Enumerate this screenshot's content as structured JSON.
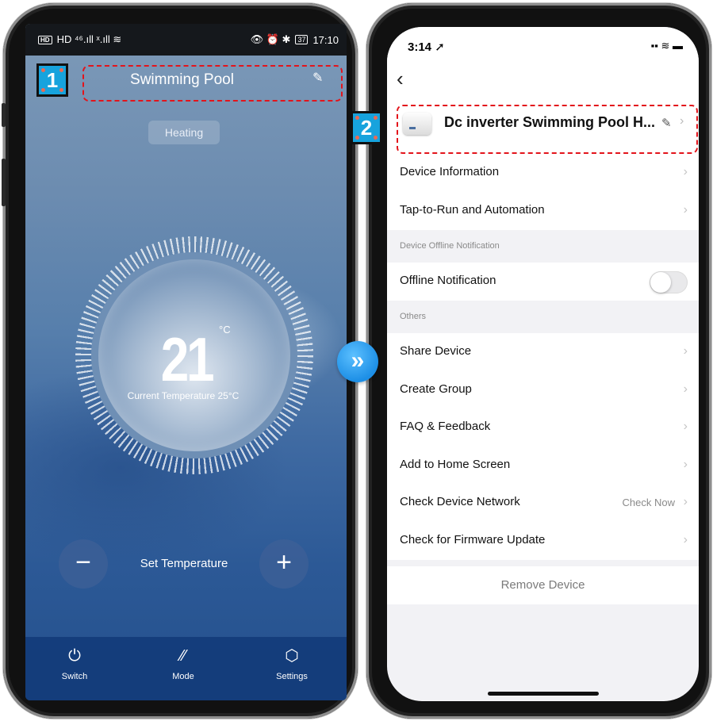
{
  "left_phone": {
    "status_bar": {
      "left": "HD ⁴⁶.ıll ˣ.ıll ≋",
      "right_icons": "👁 ⏰ ✱",
      "battery": "37",
      "time": "17:10"
    },
    "title": "Swimming Pool",
    "mode_badge": "Heating",
    "target_temperature": "21",
    "unit": "°C",
    "current_temperature": "Current Temperature 25°C",
    "set_temperature_label": "Set Temperature",
    "minus": "−",
    "plus": "+",
    "tabs": [
      {
        "label": "Switch",
        "icon": "power-icon",
        "glyph": "⏻"
      },
      {
        "label": "Mode",
        "icon": "mode-icon",
        "glyph": "⁄⁄"
      },
      {
        "label": "Settings",
        "icon": "settings-cube-icon",
        "glyph": "⬡"
      }
    ]
  },
  "right_phone": {
    "status_bar": {
      "time": "3:14 ➚",
      "icons": "▪▪ ≋ ▬"
    },
    "device_name": "Dc inverter Swimming Pool H...",
    "rows": {
      "device_information": "Device Information",
      "tap_to_run": "Tap-to-Run and Automation",
      "section_offline": "Device Offline Notification",
      "offline_notification": "Offline Notification",
      "offline_notification_enabled": false,
      "section_others": "Others",
      "share_device": "Share Device",
      "create_group": "Create Group",
      "faq": "FAQ & Feedback",
      "add_home": "Add to Home Screen",
      "check_network": "Check Device Network",
      "check_now": "Check Now",
      "firmware": "Check for Firmware Update",
      "remove": "Remove Device"
    }
  },
  "annotations": {
    "badge1": "1",
    "badge2": "2",
    "next_arrow": "»"
  },
  "colors": {
    "annotation_red": "#e3141b",
    "badge_blue": "#17a3dd",
    "arrow_blue": "#1d8fe6"
  }
}
